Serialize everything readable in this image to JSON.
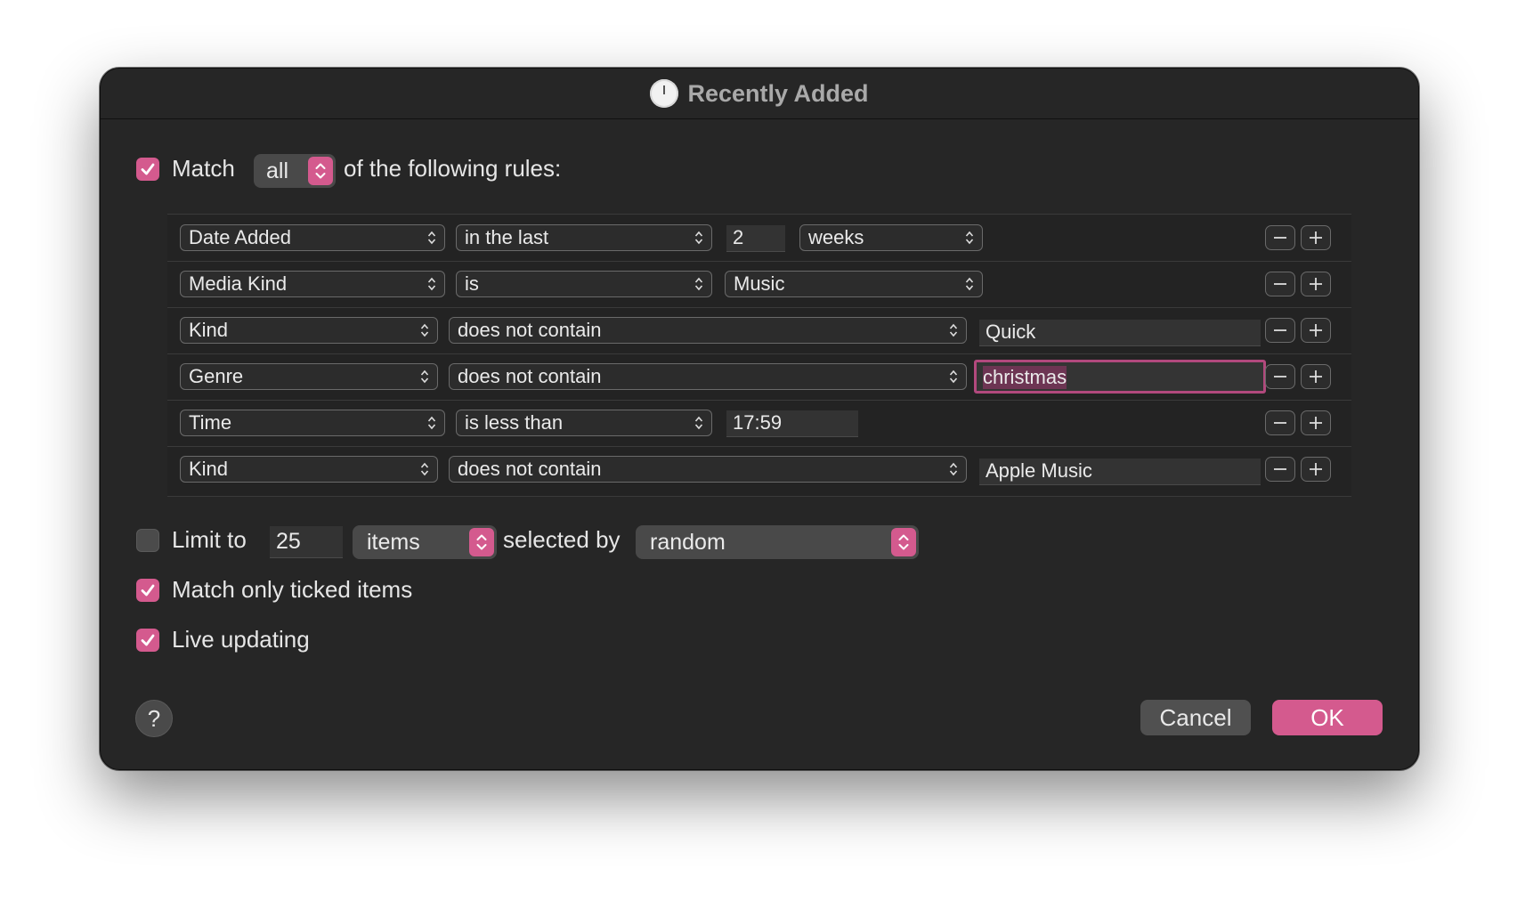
{
  "window": {
    "title": "Recently Added",
    "title_icon": "clock-icon"
  },
  "match": {
    "checked": true,
    "label": "Match",
    "scope": "all",
    "suffix": "of the following rules:"
  },
  "rules": [
    {
      "field": "Date Added",
      "operator": "in the last",
      "value": "2",
      "unit": "weeks"
    },
    {
      "field": "Media Kind",
      "operator": "is",
      "value": "Music"
    },
    {
      "field": "Kind",
      "operator": "does not contain",
      "value": "Quick"
    },
    {
      "field": "Genre",
      "operator": "does not contain",
      "value": "christmas"
    },
    {
      "field": "Time",
      "operator": "is less than",
      "value": "17:59"
    },
    {
      "field": "Kind",
      "operator": "does not contain",
      "value": "Apple Music"
    }
  ],
  "limit": {
    "checked": false,
    "label": "Limit to",
    "value": "25",
    "unit": "items",
    "selected_by_label": "selected by",
    "selected_by": "random"
  },
  "options": {
    "match_ticked": {
      "checked": true,
      "label": "Match only ticked items"
    },
    "live_updating": {
      "checked": true,
      "label": "Live updating"
    }
  },
  "buttons": {
    "help": "?",
    "cancel": "Cancel",
    "ok": "OK"
  },
  "colors": {
    "accent": "#d45a8e",
    "window_bg": "#262626"
  }
}
